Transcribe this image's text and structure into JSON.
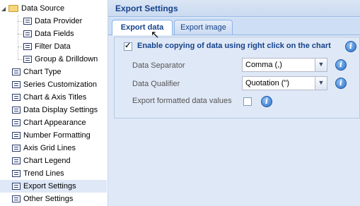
{
  "sidebar": {
    "root": {
      "label": "Data Source",
      "icon": "folder-icon",
      "expander": "◢"
    },
    "children": [
      {
        "label": "Data Provider"
      },
      {
        "label": "Data Fields"
      },
      {
        "label": "Filter Data"
      },
      {
        "label": "Group & Drilldown"
      }
    ],
    "items": [
      {
        "label": "Chart Type"
      },
      {
        "label": "Series Customization"
      },
      {
        "label": "Chart & Axis Titles"
      },
      {
        "label": "Data Display Settings"
      },
      {
        "label": "Chart Appearance"
      },
      {
        "label": "Number Formatting"
      },
      {
        "label": "Axis Grid Lines"
      },
      {
        "label": "Chart Legend"
      },
      {
        "label": "Trend Lines"
      },
      {
        "label": "Export Settings"
      },
      {
        "label": "Other Settings"
      }
    ],
    "selected": "Export Settings"
  },
  "panel": {
    "title": "Export Settings"
  },
  "tabs": [
    {
      "label": "Export data",
      "active": true
    },
    {
      "label": "Export image",
      "active": false
    }
  ],
  "form": {
    "enable_copy": {
      "label": "Enable copying of data using right click on the chart",
      "checked": true
    },
    "separator": {
      "label": "Data Separator",
      "value": "Comma (,)"
    },
    "qualifier": {
      "label": "Data Qualifier",
      "value": "Quotation (\")"
    },
    "export_formatted": {
      "label": "Export formatted data values",
      "checked": false
    }
  },
  "colors": {
    "accent": "#15428b",
    "panel_bg": "#dfe8f6",
    "selected_bg": "#dfe8f6"
  }
}
